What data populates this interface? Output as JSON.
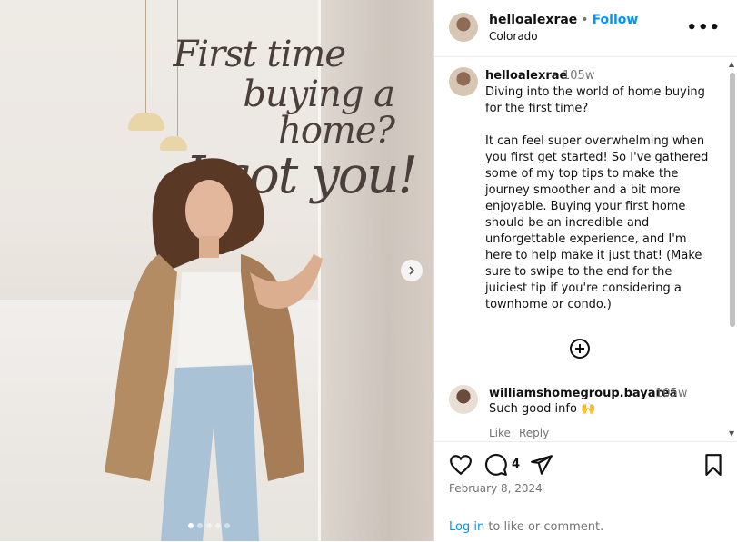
{
  "media": {
    "headline": {
      "line1": "First time",
      "line2": "buying a home?",
      "line3": "I got you!"
    },
    "carousel": {
      "slide_count": 5,
      "active_index": 0
    }
  },
  "post": {
    "username": "helloalexrae",
    "separator": "•",
    "follow_label": "Follow",
    "location": "Colorado",
    "more_label": "•••"
  },
  "caption": {
    "username": "helloalexrae",
    "time": "105w",
    "text": "Diving into the world of home buying for the first time?\n\nIt can feel super overwhelming when you first get started! So I've gathered some of my top tips to make the journey smoother and a bit more enjoyable. Buying your first home should be an incredible and unforgettable experience, and I'm here to help make it just that! (Make sure to swipe to the end for the juiciest tip if you're considering a townhome or condo.)"
  },
  "comment": {
    "username": "williamshomegroup.bayarea",
    "time": "105w",
    "text": "Such good info 🙌",
    "like_label": "Like",
    "reply_label": "Reply"
  },
  "actions": {
    "comment_count": "4",
    "date": "February 8, 2024",
    "login_link": "Log in",
    "login_rest": " to like or comment."
  },
  "colors": {
    "accent": "#0095f6",
    "muted": "#737373"
  }
}
